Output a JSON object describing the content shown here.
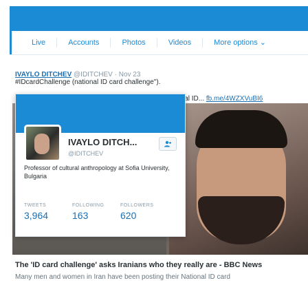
{
  "tabs": [
    {
      "label": "Live"
    },
    {
      "label": "Accounts"
    },
    {
      "label": "Photos"
    },
    {
      "label": "Videos"
    },
    {
      "label": "More options ⌄"
    }
  ],
  "tweet": {
    "author": "IVAYLO DITCHEV",
    "handle_time": "@IDITCHEV · Nov 23",
    "line2": "#IDcardChallenge (national ID card challenge\").",
    "line3_text": "ial ID...",
    "link": "fb.me/4WZXVuBI6"
  },
  "card": {
    "name": "IVAYLO DITCH...",
    "handle": "@IDITCHEV",
    "bio": "Professor of cultural anthropology at Sofia University, Bulgaria",
    "follow_icon": "follow-user-icon",
    "stats": [
      {
        "label": "TWEETS",
        "value": "3,964"
      },
      {
        "label": "FOLLOWING",
        "value": "163"
      },
      {
        "label": "FOLLOWERS",
        "value": "620"
      }
    ]
  },
  "article": {
    "headline": "The 'ID card challenge' asks Iranians who they really are - BBC News",
    "snippet": "Many men and women in Iran have been posting their National ID card"
  },
  "colors": {
    "accent": "#1b8bd6",
    "link": "#1b6fb3"
  }
}
